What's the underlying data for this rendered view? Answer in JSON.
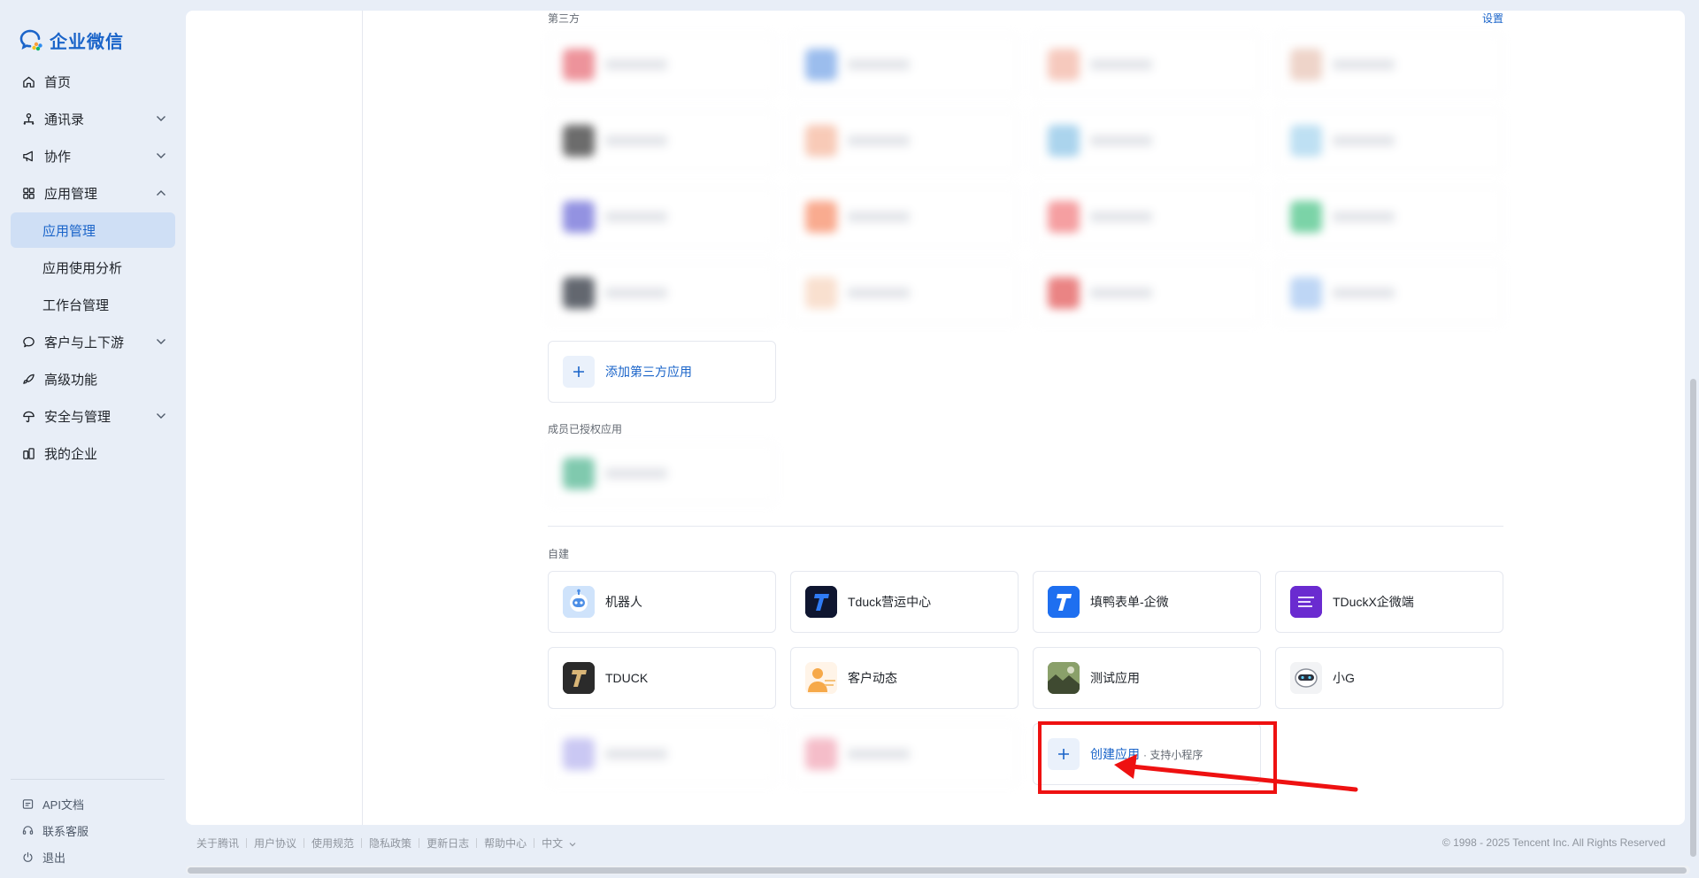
{
  "brand": {
    "name": "企业微信",
    "color": "#1a64c9"
  },
  "sidebar": {
    "items": [
      {
        "label": "首页",
        "icon": "home-icon",
        "expandable": false
      },
      {
        "label": "通讯录",
        "icon": "org-chart-icon",
        "expandable": true,
        "chevron": "chevron-down-icon"
      },
      {
        "label": "协作",
        "icon": "megaphone-icon",
        "expandable": true,
        "chevron": "chevron-down-icon"
      },
      {
        "label": "应用管理",
        "icon": "grid-apps-icon",
        "expandable": true,
        "chevron": "chevron-up-icon"
      },
      {
        "label": "客户与上下游",
        "icon": "chat-bubble-icon",
        "expandable": true,
        "chevron": "chevron-down-icon"
      },
      {
        "label": "高级功能",
        "icon": "rocket-icon",
        "expandable": false
      },
      {
        "label": "安全与管理",
        "icon": "umbrella-icon",
        "expandable": true,
        "chevron": "chevron-down-icon"
      },
      {
        "label": "我的企业",
        "icon": "building-icon",
        "expandable": false
      }
    ],
    "subitems": [
      {
        "label": "应用管理",
        "active": true
      },
      {
        "label": "应用使用分析",
        "active": false
      },
      {
        "label": "工作台管理",
        "active": false
      }
    ],
    "footer": [
      {
        "label": "API文档",
        "icon": "document-icon"
      },
      {
        "label": "联系客服",
        "icon": "headset-icon"
      },
      {
        "label": "退出",
        "icon": "power-icon"
      }
    ]
  },
  "third_party": {
    "title": "第三方",
    "settings_label": "设置",
    "blurred_icon_colors": [
      "#e8707a",
      "#7aa7e8",
      "#f4b8a8",
      "#e9c6b8",
      "#3b3b3b",
      "#f6b9a0",
      "#8fc6e8",
      "#a9d6ef",
      "#6f6ed8",
      "#f88f6a",
      "#f27f82",
      "#4fc58a",
      "#2f3540",
      "#f8d6c0",
      "#e45b5b",
      "#a9c9f2"
    ],
    "add_label": "添加第三方应用"
  },
  "member_authorized": {
    "title": "成员已授权应用",
    "blurred_icon_colors": [
      "#56b894"
    ]
  },
  "self_built": {
    "title": "自建",
    "apps": [
      {
        "name": "机器人",
        "icon": "robot-icon"
      },
      {
        "name": "Tduck营运中心",
        "icon": "tduck-t-icon"
      },
      {
        "name": "填鸭表单-企微",
        "icon": "tduck-form-icon"
      },
      {
        "name": "TDuckX企微端",
        "icon": "tduckx-icon"
      },
      {
        "name": "TDUCK",
        "icon": "tduck-dark-icon"
      },
      {
        "name": "客户动态",
        "icon": "person-icon"
      },
      {
        "name": "测试应用",
        "icon": "landscape-photo-icon"
      },
      {
        "name": "小G",
        "icon": "robot-head-icon"
      }
    ],
    "blurred_icon_colors": [
      "#b9b6ef",
      "#f2a8b8"
    ],
    "create_label": "创建应用",
    "create_sub": "· 支持小程序"
  },
  "annotation": {
    "highlight_color": "#ee1111",
    "arrow": "red-arrow-icon"
  },
  "footer": {
    "links": [
      "关于腾讯",
      "用户协议",
      "使用规范",
      "隐私政策",
      "更新日志",
      "帮助中心",
      "中文"
    ],
    "copyright": "© 1998 - 2025 Tencent Inc. All Rights Reserved"
  }
}
